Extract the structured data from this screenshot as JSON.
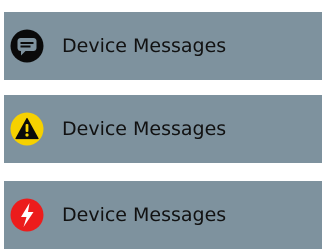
{
  "notifications": [
    {
      "label": "Device Messages",
      "icon": "message-icon",
      "badge_color": "#0a0a0a"
    },
    {
      "label": "Device Messages",
      "icon": "warning-icon",
      "badge_color": "#f6d100"
    },
    {
      "label": "Device Messages",
      "icon": "lightning-icon",
      "badge_color": "#ec1c1c"
    }
  ]
}
